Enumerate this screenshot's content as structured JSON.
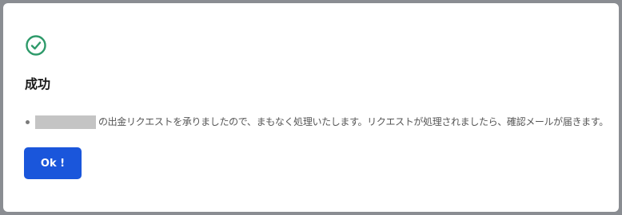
{
  "dialog": {
    "icon": "check-circle-icon",
    "title": "成功",
    "message": "の出金リクエストを承りましたので、まもなく処理いたします。リクエストが処理されましたら、確認メールが届きます。",
    "ok_label": "Ok !"
  },
  "colors": {
    "success_green": "#2e9a6a",
    "button_blue": "#1a56db",
    "overlay_gray": "#8a8d92"
  }
}
